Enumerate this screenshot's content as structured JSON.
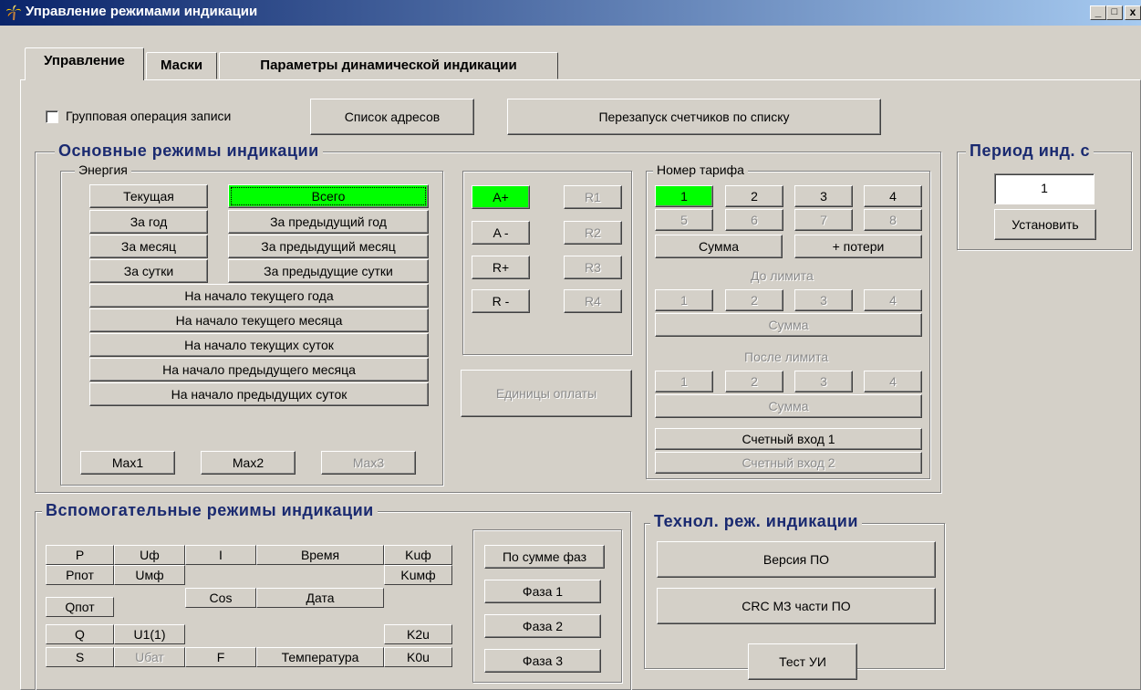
{
  "window": {
    "title": "Управление режимами индикации",
    "minimize": "_",
    "maximize": "□",
    "close": "x"
  },
  "tabs": [
    "Управление",
    "Маски",
    "Параметры динамической индикации"
  ],
  "top": {
    "group_write_label": "Групповая операция записи",
    "address_list": "Список адресов",
    "restart_meters": "Перезапуск счетчиков по списку"
  },
  "main": {
    "title": "Основные режимы индикации",
    "energy": {
      "title": "Энергия",
      "current": "Текущая",
      "total": "Всего",
      "per_year": "За год",
      "prev_year": "За предыдущий год",
      "per_month": "За месяц",
      "prev_month": "За предыдущий месяц",
      "per_day": "За сутки",
      "prev_day": "За предыдущие сутки",
      "start_cur_year": "На начало текущего года",
      "start_cur_month": "На начало текущего месяца",
      "start_cur_day": "На начало текущих суток",
      "start_prev_month": "На начало предыдущего месяца",
      "start_prev_day": "На начало предыдущих суток",
      "max1": "Max1",
      "max2": "Max2",
      "max3": "Max3"
    },
    "energy_type": {
      "a_plus": "A+",
      "a_minus": "A -",
      "r_plus": "R+",
      "r_minus": "R -",
      "r1": "R1",
      "r2": "R2",
      "r3": "R3",
      "r4": "R4"
    },
    "payment_units": "Единицы оплаты",
    "tariff": {
      "title": "Номер тарифа",
      "nums": [
        "1",
        "2",
        "3",
        "4",
        "5",
        "6",
        "7",
        "8"
      ],
      "sum": "Сумма",
      "losses": "+ потери",
      "before_limit": "До лимита",
      "after_limit": "После лимита",
      "small_nums": [
        "1",
        "2",
        "3",
        "4"
      ],
      "counter_in_1": "Счетный вход 1",
      "counter_in_2": "Счетный вход 2"
    }
  },
  "period": {
    "title": "Период инд. с",
    "value": "1",
    "set": "Установить"
  },
  "aux": {
    "title": "Вспомогательные режимы индикации",
    "cells": {
      "p": "P",
      "uf": "Uф",
      "i": "I",
      "time": "Время",
      "kuf": "Kuф",
      "ppot": "Pпот",
      "umf": "Uмф",
      "kumf": "Kuмф",
      "qpot": "Qпот",
      "cos": "Cos",
      "date": "Дата",
      "q": "Q",
      "u11": "U1(1)",
      "k2u": "K2u",
      "s": "S",
      "ubat": "Uбат",
      "f": "F",
      "temp": "Температура",
      "k0u": "K0u"
    },
    "phase_sum": "По сумме фаз",
    "phase1": "Фаза 1",
    "phase2": "Фаза 2",
    "phase3": "Фаза 3"
  },
  "tech": {
    "title": "Технол. реж. индикации",
    "fw_version": "Версия ПО",
    "crc": "CRC МЗ части ПО",
    "ui_test": "Тест УИ"
  },
  "colors": {
    "titlebar_start": "#0a246a",
    "titlebar_end": "#a6caf0",
    "active_green": "#00ff00",
    "group_title": "#1a2a70",
    "face": "#d4d0c8"
  }
}
